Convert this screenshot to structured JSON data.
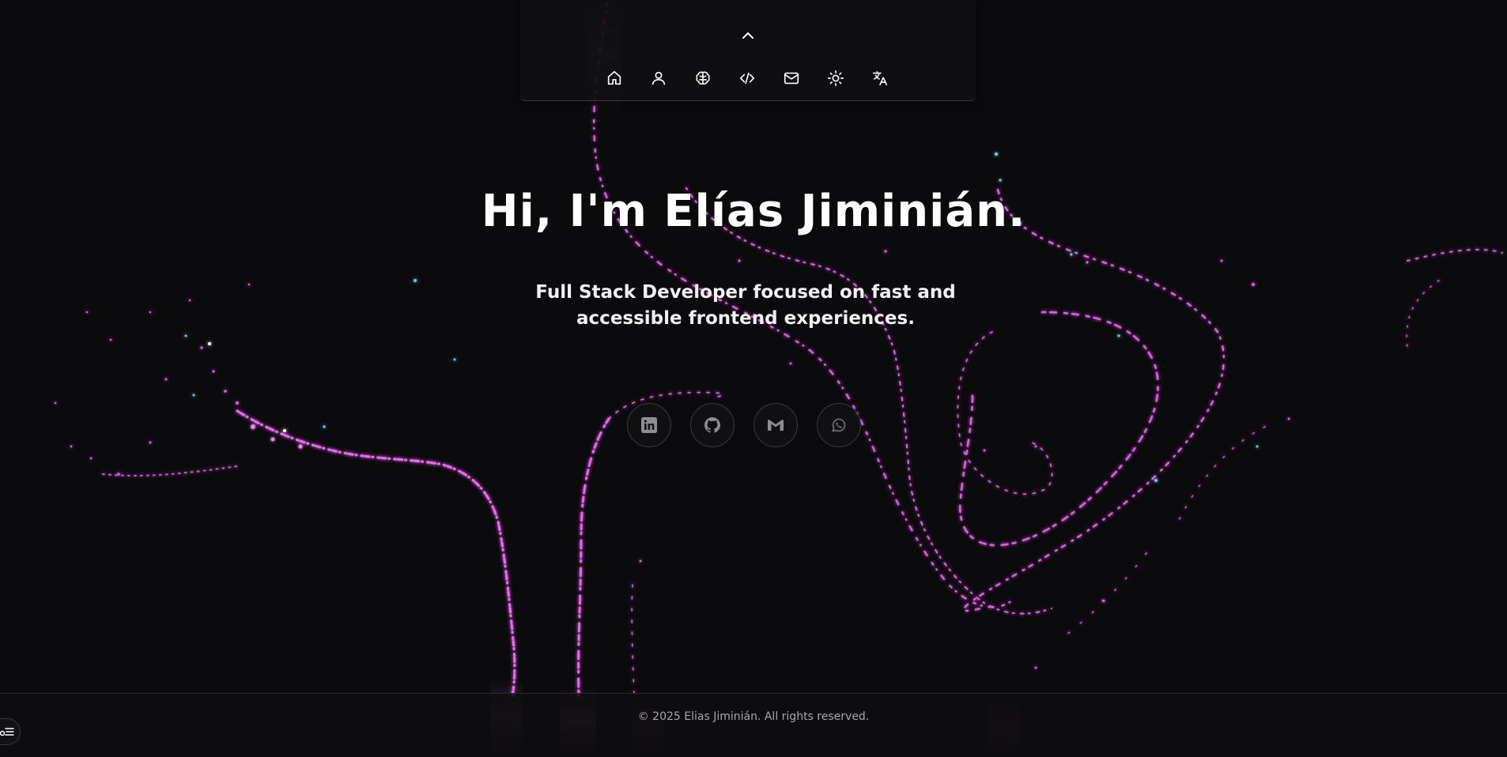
{
  "colors": {
    "background": "#0b0a0c",
    "particle_primary": "#e05ae8",
    "particle_secondary": "#5ad6e8",
    "text": "#ffffff",
    "muted_text": "#a9a6ac"
  },
  "nav": {
    "collapse_icon": "chevron-up-icon",
    "items": [
      {
        "name": "home",
        "icon": "home-icon"
      },
      {
        "name": "about",
        "icon": "user-icon"
      },
      {
        "name": "skills",
        "icon": "brain-icon"
      },
      {
        "name": "projects",
        "icon": "code-icon"
      },
      {
        "name": "contact",
        "icon": "mail-icon"
      },
      {
        "name": "theme",
        "icon": "sun-icon"
      },
      {
        "name": "language",
        "icon": "translate-icon"
      }
    ]
  },
  "hero": {
    "title": "Hi, I'm Elías Jiminián.",
    "subtitle": "Full Stack Developer focused on fast and accessible frontend experiences."
  },
  "social": [
    {
      "name": "linkedin",
      "icon": "linkedin-icon"
    },
    {
      "name": "github",
      "icon": "github-icon"
    },
    {
      "name": "gmail",
      "icon": "gmail-icon"
    },
    {
      "name": "whatsapp",
      "icon": "whatsapp-icon"
    }
  ],
  "footer": {
    "copyright": "© 2025 Elias Jiminián. All rights reserved."
  },
  "accessibility": {
    "icon": "accessibility-settings-icon"
  }
}
